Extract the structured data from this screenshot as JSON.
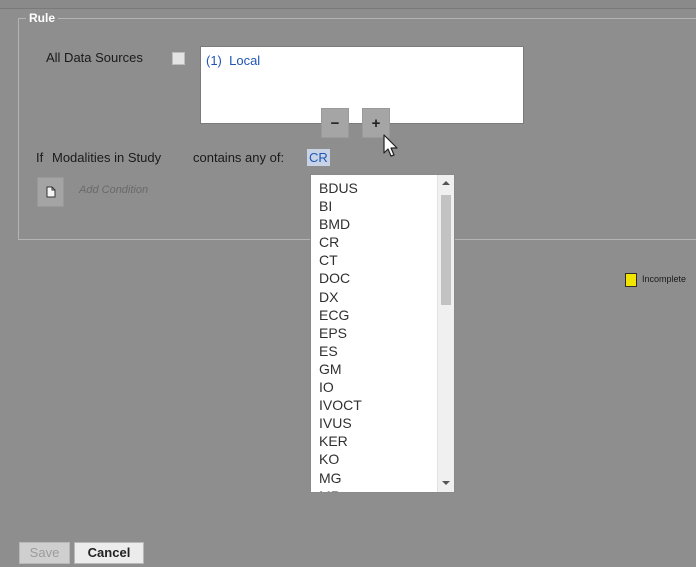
{
  "rule": {
    "legend": "Rule",
    "all_sources_label": "All Data Sources",
    "sources": [
      "(1)  Local"
    ],
    "remove_label": "−",
    "add_label": "+",
    "condition": {
      "prefix": "If",
      "field": "Modalities in Study",
      "operator": "contains any of:",
      "value": "CR"
    },
    "add_condition_label": "Add Condition"
  },
  "dropdown": {
    "options": [
      "BDUS",
      "BI",
      "BMD",
      "CR",
      "CT",
      "DOC",
      "DX",
      "ECG",
      "EPS",
      "ES",
      "GM",
      "IO",
      "IVOCT",
      "IVUS",
      "KER",
      "KO",
      "MG",
      "MR"
    ]
  },
  "legend_key": {
    "label": "Incomplete",
    "color": "#f2e600"
  },
  "footer": {
    "save_label": "Save",
    "cancel_label": "Cancel"
  }
}
